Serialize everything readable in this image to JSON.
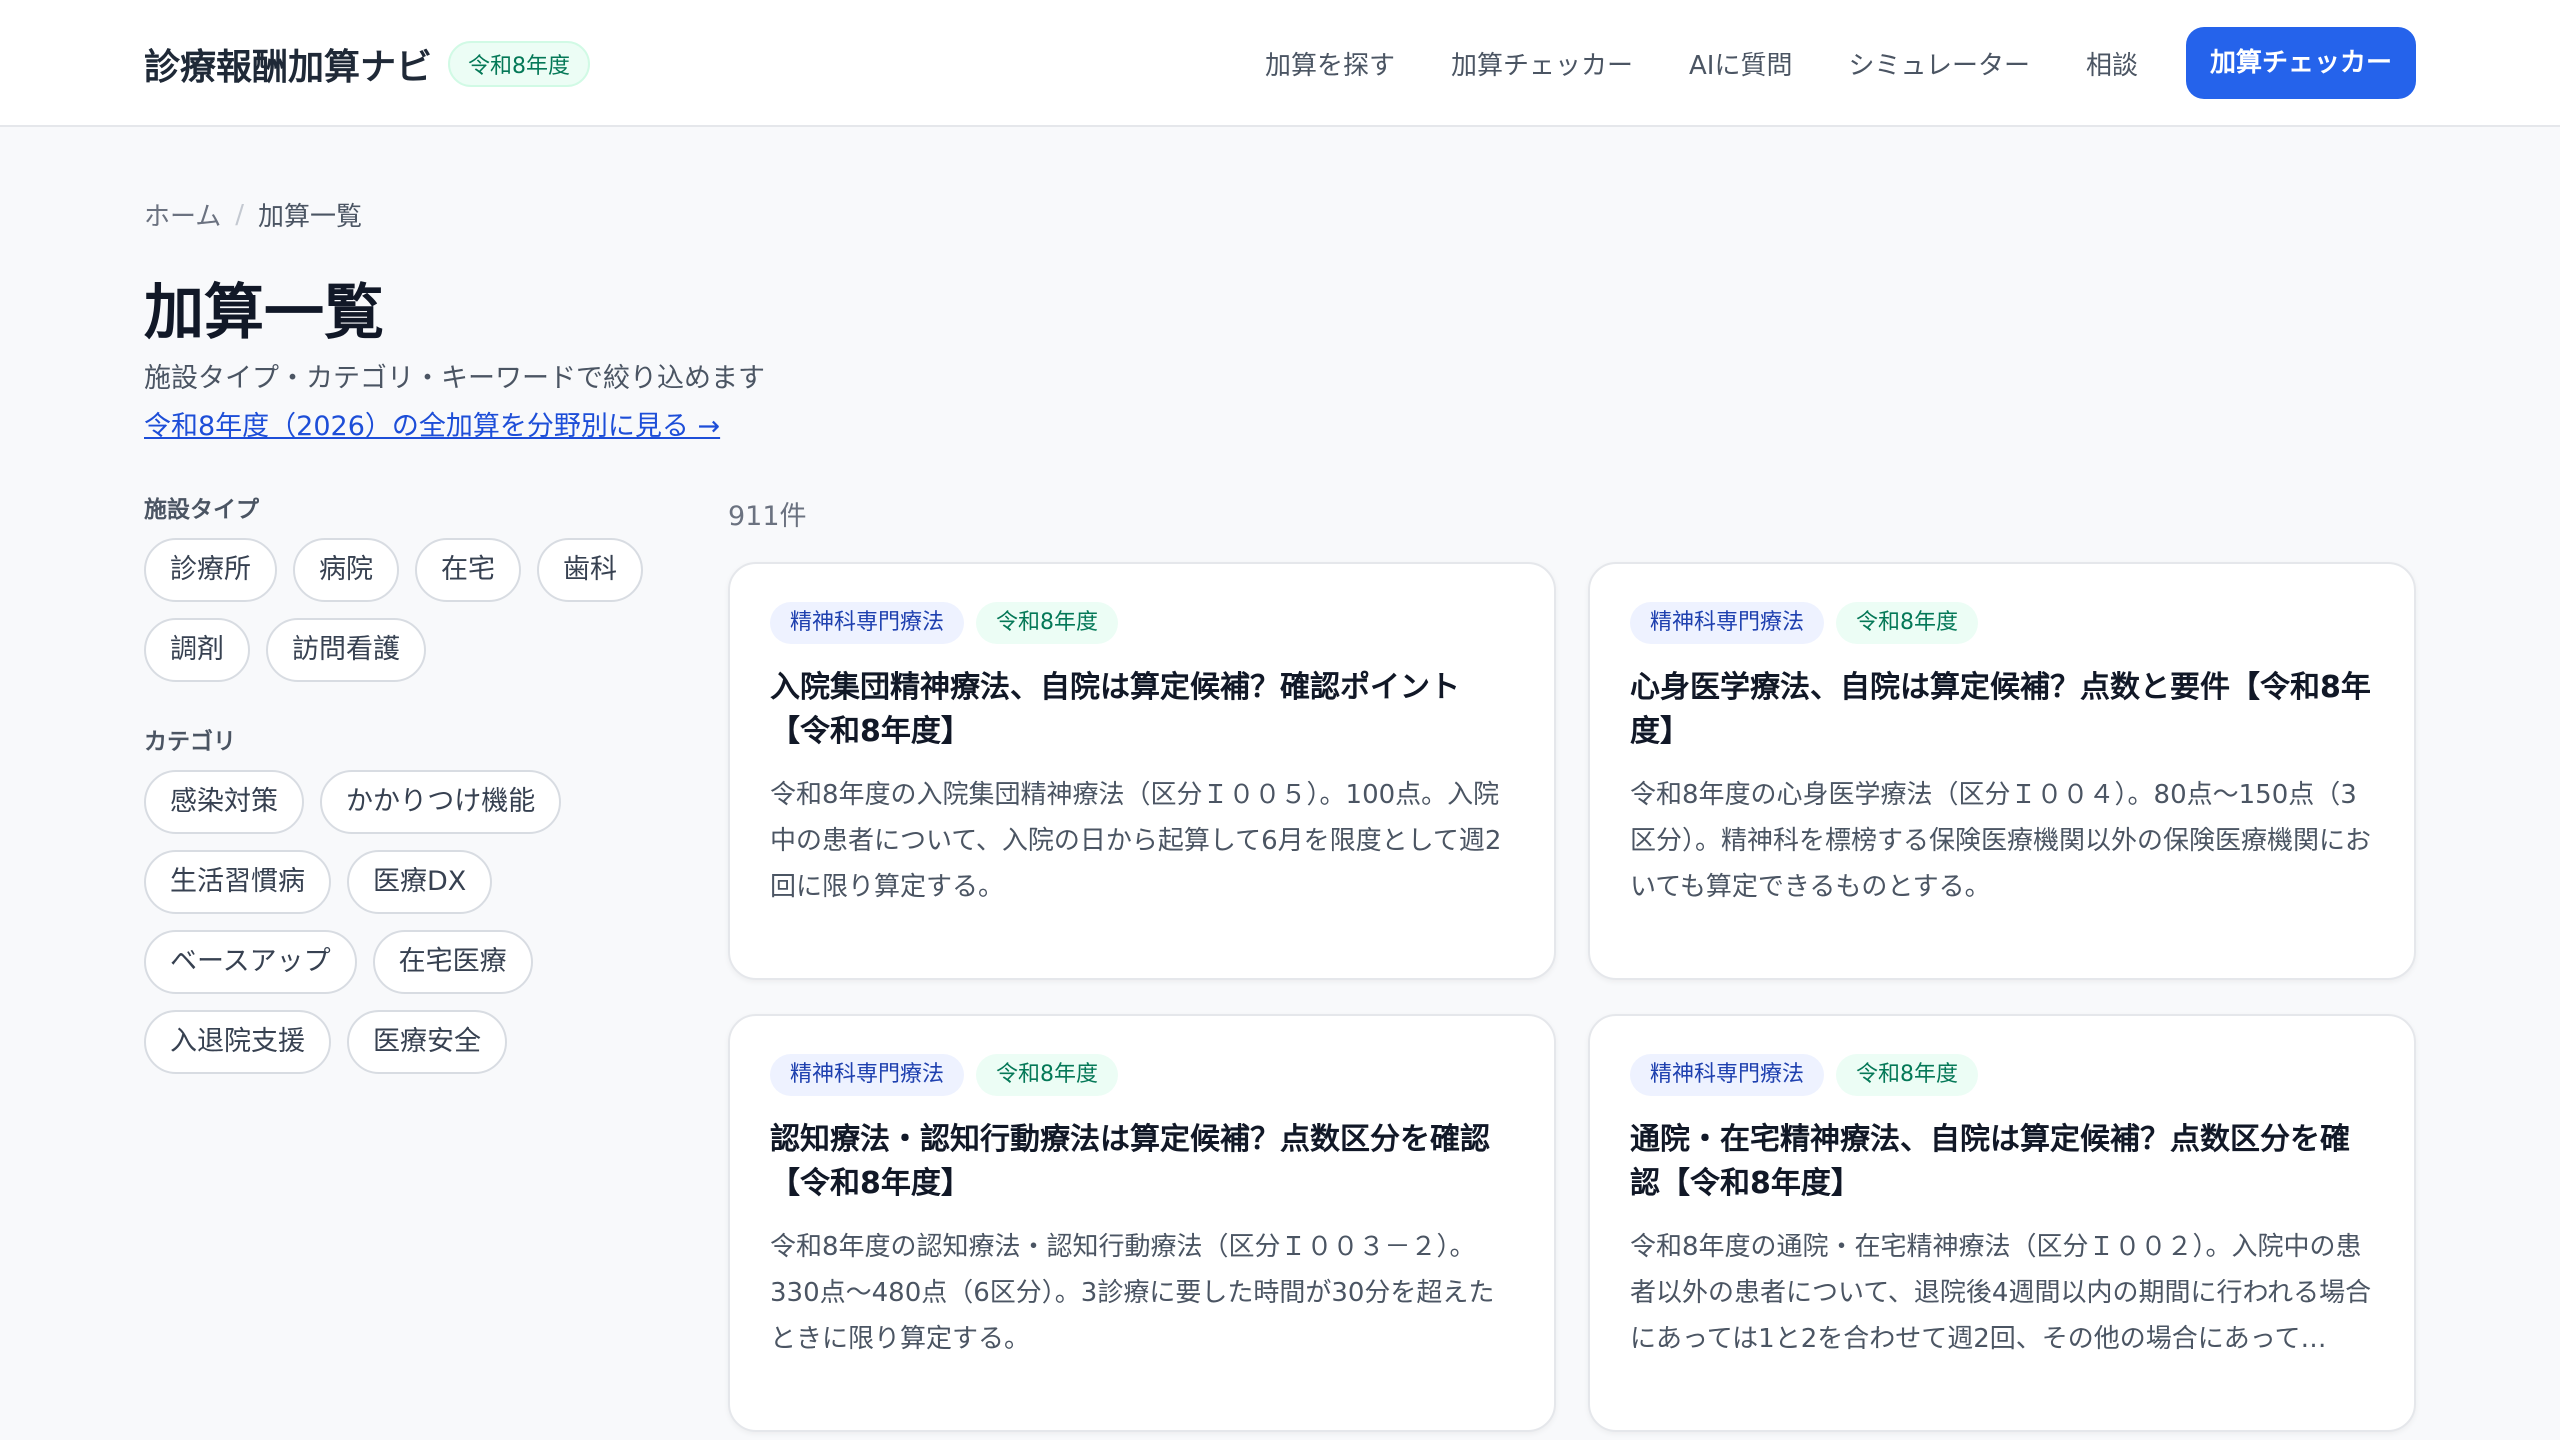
{
  "header": {
    "brand_name": "診療報酬加算ナビ",
    "brand_badge": "令和8年度",
    "nav": [
      "加算を探す",
      "加算チェッカー",
      "AIに質問",
      "シミュレーター",
      "相談"
    ],
    "cta": "加算チェッカー"
  },
  "breadcrumb": {
    "home": "ホーム",
    "separator": "/",
    "current": "加算一覧"
  },
  "page": {
    "title": "加算一覧",
    "subtitle": "施設タイプ・カテゴリ・キーワードで絞り込めます",
    "year_link": "令和8年度（2026）の全加算を分野別に見る →"
  },
  "filters": {
    "facility_label": "施設タイプ",
    "facility_types": [
      "診療所",
      "病院",
      "在宅",
      "歯科",
      "調剤",
      "訪問看護"
    ],
    "category_label": "カテゴリ",
    "categories": [
      "感染対策",
      "かかりつけ機能",
      "生活習慣病",
      "医療DX",
      "ベースアップ",
      "在宅医療",
      "入退院支援",
      "医療安全"
    ]
  },
  "results": {
    "count": "911件",
    "cards": [
      {
        "category": "精神科専門療法",
        "year": "令和8年度",
        "title": "入院集団精神療法、自院は算定候補？確認ポイント【令和8年度】",
        "description": "令和8年度の入院集団精神療法（区分Ｉ００５）。100点。入院中の患者について、入院の日から起算して6月を限度として週2回に限り算定する。"
      },
      {
        "category": "精神科専門療法",
        "year": "令和8年度",
        "title": "心身医学療法、自院は算定候補？点数と要件【令和8年度】",
        "description": "令和8年度の心身医学療法（区分Ｉ００４）。80点〜150点（3区分）。精神科を標榜する保険医療機関以外の保険医療機関においても算定できるものとする。"
      },
      {
        "category": "精神科専門療法",
        "year": "令和8年度",
        "title": "認知療法・認知行動療法は算定候補？点数区分を確認【令和8年度】",
        "description": "令和8年度の認知療法・認知行動療法（区分Ｉ００３－２）。330点〜480点（6区分）。3診療に要した時間が30分を超えたときに限り算定する。"
      },
      {
        "category": "精神科専門療法",
        "year": "令和8年度",
        "title": "通院・在宅精神療法、自院は算定候補？点数区分を確認【令和8年度】",
        "description": "令和8年度の通院・在宅精神療法（区分Ｉ００２）。入院中の患者以外の患者について、退院後4週間以内の期間に行われる場合にあっては1と2を合わせて週2回、その他の場合にあって…"
      }
    ]
  }
}
